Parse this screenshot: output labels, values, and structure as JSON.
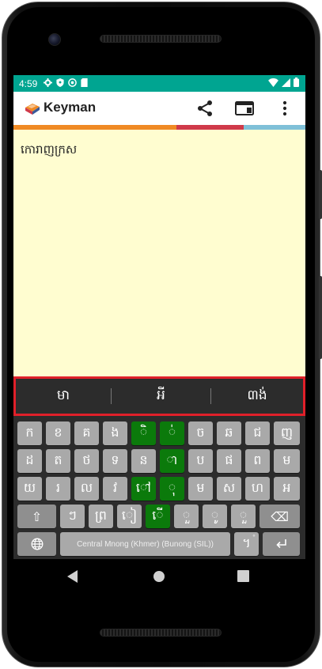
{
  "status_bar": {
    "time": "4:59",
    "left_icons": [
      "settings-icon",
      "shield-icon",
      "vpn-icon",
      "sd-card-icon"
    ],
    "right_icons": [
      "wifi-icon",
      "signal-icon",
      "battery-icon"
    ]
  },
  "app_bar": {
    "title": "Keyman",
    "actions": [
      "share-icon",
      "window-icon",
      "more-vert-icon"
    ]
  },
  "colors": {
    "status_bar": "#00a591",
    "stripe_orange": "#f08a24",
    "stripe_red": "#d03a4a",
    "stripe_blue": "#7fc0d8",
    "text_area": "#fffdd0",
    "highlight": "#e0202a",
    "key_green": "#0b7a0b"
  },
  "text_area": {
    "content": "កោរាញក្រស"
  },
  "suggestions": [
    "មា",
    "អី",
    "៣ង់"
  ],
  "keyboard": {
    "row1": [
      "ក",
      "ខ",
      "គ",
      "ង",
      "ិ",
      "់",
      "ច",
      "ឆ",
      "ជ",
      "ញ"
    ],
    "row2": [
      "ដ",
      "ត",
      "ថ",
      "ទ",
      "ន",
      "ា",
      "ប",
      "ផ",
      "ព",
      "ម"
    ],
    "row3": [
      "យ",
      "រ",
      "ល",
      "វ",
      "ៅ",
      "ុ",
      "ម",
      "ស",
      "ហ",
      "អ"
    ],
    "row4": [
      "⇧",
      "ៗ",
      "ព្រ",
      "ៀ",
      "ើ",
      "ួ",
      "ូ",
      "ួ",
      "⌫"
    ],
    "row5": {
      "globe": "globe-icon",
      "space_label": "Central Mnong (Khmer) (Bunong (SIL))",
      "period": "។",
      "period_hint": "°",
      "enter": "enter-icon"
    }
  },
  "nav_bar": [
    "back-icon",
    "home-icon",
    "recents-icon"
  ]
}
